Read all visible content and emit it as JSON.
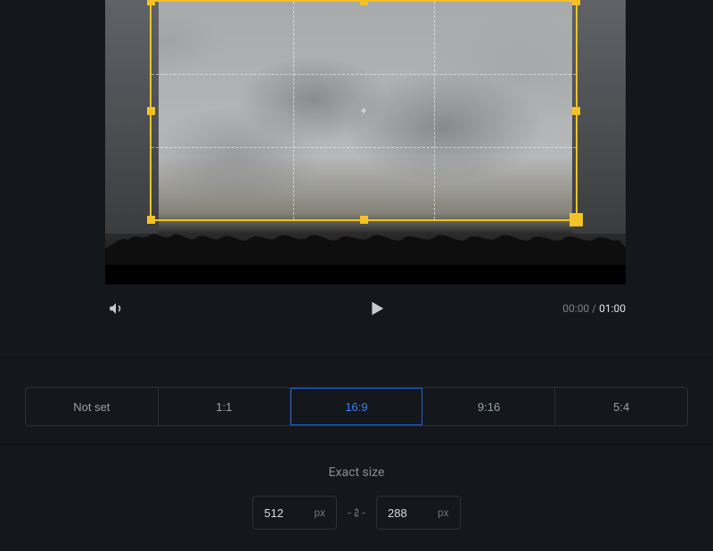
{
  "playback": {
    "current_time": "00:00",
    "separator": "/",
    "total_time": "01:00"
  },
  "crop": {
    "accent": "#f4c224",
    "grid": "3x3"
  },
  "ratios": {
    "options": [
      {
        "label": "Not set",
        "value": "none"
      },
      {
        "label": "1:1",
        "value": "1_1"
      },
      {
        "label": "16:9",
        "value": "16_9"
      },
      {
        "label": "9:16",
        "value": "9_16"
      },
      {
        "label": "5:4",
        "value": "5_4"
      }
    ],
    "selected": "16_9"
  },
  "exact_size": {
    "title": "Exact size",
    "width": "512",
    "height": "288",
    "unit": "px",
    "locked": true
  }
}
